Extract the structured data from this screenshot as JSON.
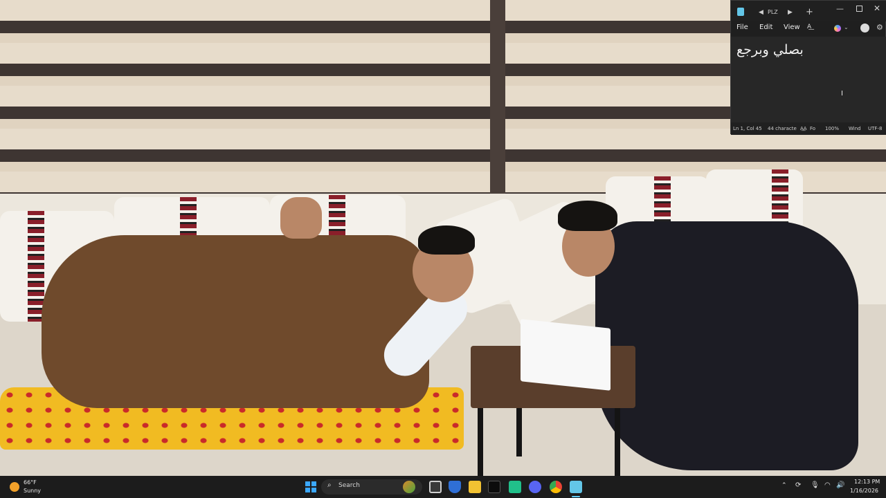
{
  "notepad": {
    "tab_title": "PLZ",
    "new_tab_symbol": "+",
    "menu": {
      "file": "File",
      "edit": "Edit",
      "view": "View"
    },
    "content": "بصلي وبرجع",
    "status": {
      "position": "Ln 1, Col 45",
      "characters": "44 characte",
      "font": "Fo",
      "zoom": "100%",
      "line_ending": "Wind",
      "encoding": "UTF-8"
    }
  },
  "taskbar": {
    "weather": {
      "temperature": "66°F",
      "condition": "Sunny"
    },
    "search_label": "Search",
    "clock": {
      "time": "12:13 PM",
      "date": "1/16/2026"
    }
  },
  "colors": {
    "taskbar_bg": "#1c1c1c",
    "notepad_bg": "#272727",
    "accent": "#60cdff",
    "windows_logo": "#3ba8ff"
  }
}
